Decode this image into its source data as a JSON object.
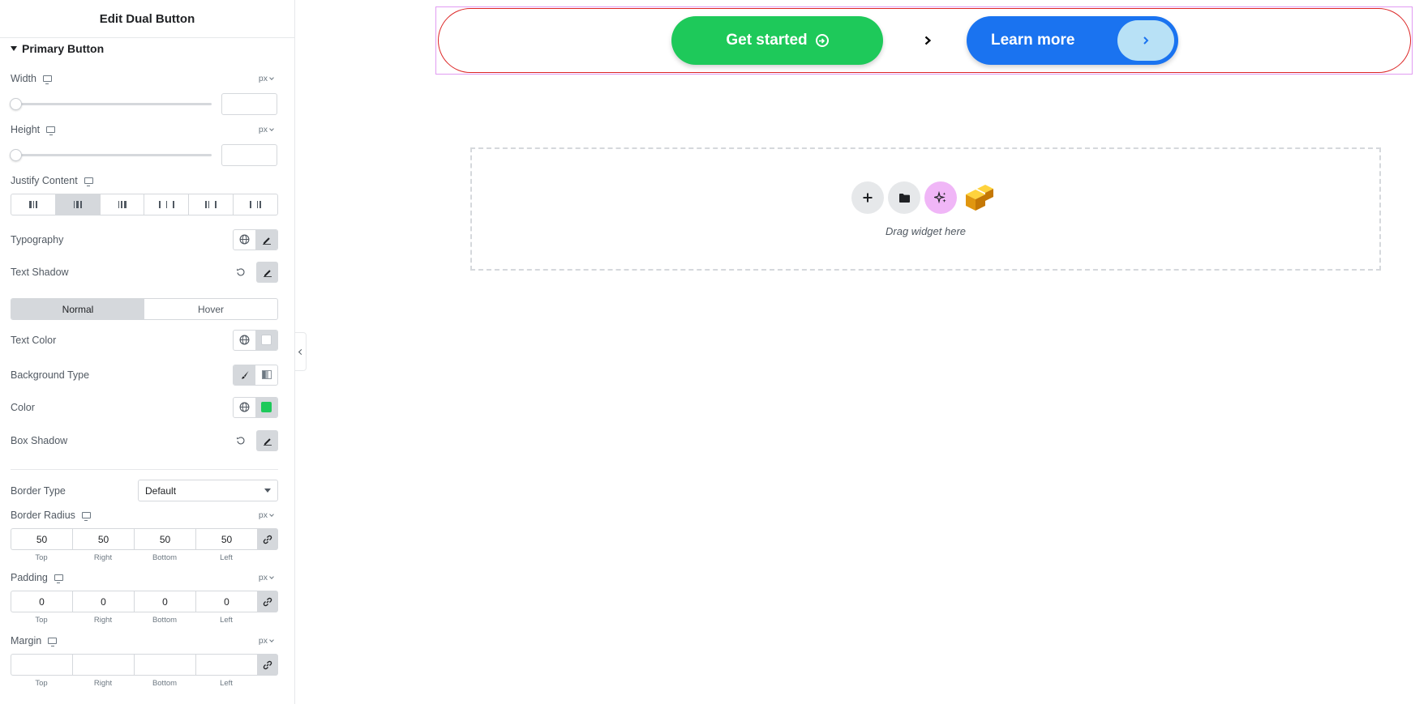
{
  "panel": {
    "title": "Edit Dual Button",
    "section_title": "Primary Button",
    "width": {
      "label": "Width",
      "unit": "px",
      "value": ""
    },
    "height": {
      "label": "Height",
      "unit": "px",
      "value": ""
    },
    "justify_content": {
      "label": "Justify Content",
      "selected_index": 1,
      "option_count": 6
    },
    "typography": {
      "label": "Typography"
    },
    "text_shadow": {
      "label": "Text Shadow"
    },
    "state_tabs": [
      {
        "label": "Normal",
        "active": true
      },
      {
        "label": "Hover",
        "active": false
      }
    ],
    "text_color": {
      "label": "Text Color",
      "value": "#ffffff"
    },
    "background_type": {
      "label": "Background Type"
    },
    "color": {
      "label": "Color",
      "value": "#1ec95a"
    },
    "box_shadow": {
      "label": "Box Shadow"
    },
    "border_type": {
      "label": "Border Type",
      "value": "Default"
    },
    "border_radius": {
      "label": "Border Radius",
      "unit": "px",
      "top": "50",
      "right": "50",
      "bottom": "50",
      "left": "50"
    },
    "padding": {
      "label": "Padding",
      "unit": "px",
      "top": "0",
      "right": "0",
      "bottom": "0",
      "left": "0"
    },
    "margin": {
      "label": "Margin",
      "unit": "px",
      "top": "",
      "right": "",
      "bottom": "",
      "left": ""
    },
    "dim_labels": {
      "top": "Top",
      "right": "Right",
      "bottom": "Bottom",
      "left": "Left"
    }
  },
  "canvas": {
    "primary_button": {
      "label": "Get started",
      "color": "#1ec95a",
      "icon": "circle-arrow-right-icon"
    },
    "connector_icon": "chevron-right-icon",
    "secondary_button": {
      "label": "Learn more",
      "color": "#1a73f0",
      "icon": "chevron-right-icon"
    },
    "drop_zone": {
      "text": "Drag widget here"
    }
  }
}
